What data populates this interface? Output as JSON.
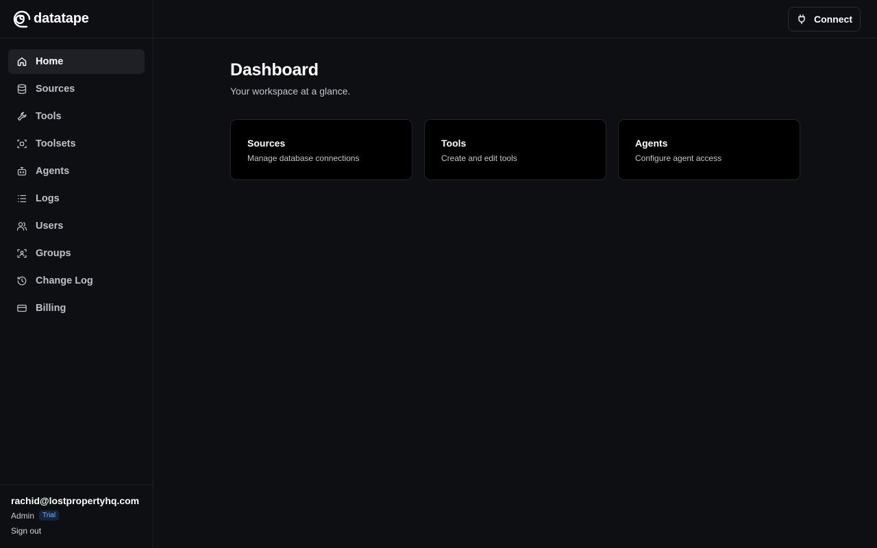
{
  "brand": {
    "name": "datatape"
  },
  "sidebar": {
    "items": [
      {
        "label": "Home",
        "icon": "home-icon",
        "active": true
      },
      {
        "label": "Sources",
        "icon": "database-icon"
      },
      {
        "label": "Tools",
        "icon": "wrench-icon"
      },
      {
        "label": "Toolsets",
        "icon": "scan-icon"
      },
      {
        "label": "Agents",
        "icon": "bot-icon"
      },
      {
        "label": "Logs",
        "icon": "list-icon"
      },
      {
        "label": "Users",
        "icon": "users-icon"
      },
      {
        "label": "Groups",
        "icon": "user-scan-icon"
      },
      {
        "label": "Change Log",
        "icon": "history-icon"
      },
      {
        "label": "Billing",
        "icon": "credit-card-icon"
      }
    ]
  },
  "user": {
    "email": "rachid@lostpropertyhq.com",
    "role": "Admin",
    "badge": "Trial",
    "signout_label": "Sign out"
  },
  "header": {
    "connect_label": "Connect"
  },
  "main": {
    "title": "Dashboard",
    "subtitle": "Your workspace at a glance.",
    "cards": [
      {
        "title": "Sources",
        "description": "Manage database connections"
      },
      {
        "title": "Tools",
        "description": "Create and edit tools"
      },
      {
        "title": "Agents",
        "description": "Configure agent access"
      }
    ]
  },
  "colors": {
    "background": "#0e0f13",
    "card_background": "#000000",
    "active_nav": "#1f2026",
    "badge_text": "#7fb0ff",
    "badge_background": "#15243d"
  }
}
